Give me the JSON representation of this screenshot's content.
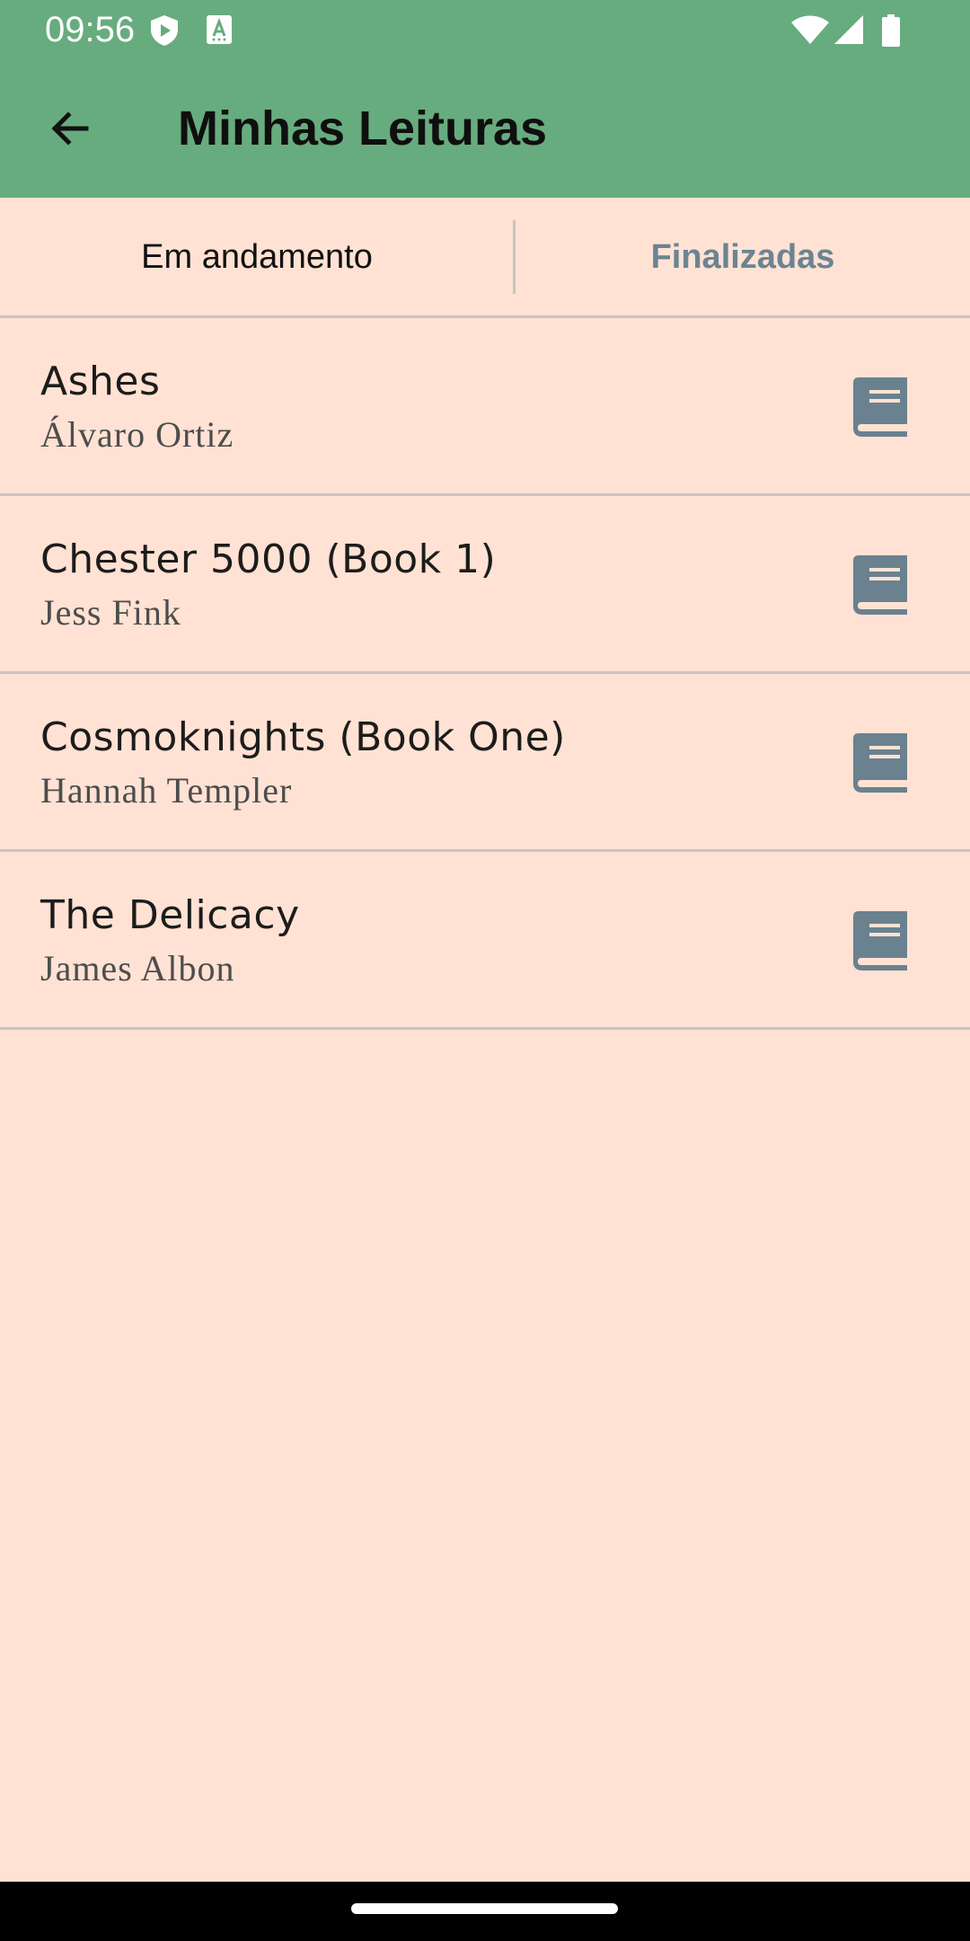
{
  "status_bar": {
    "time": "09:56",
    "icons": [
      "shield-play-icon",
      "accessibility-a-icon",
      "wifi-icon",
      "signal-icon",
      "battery-icon"
    ]
  },
  "app_bar": {
    "title": "Minhas Leituras",
    "back_icon": "arrow-back-icon",
    "background_color": "#67ac7e"
  },
  "tabs": [
    {
      "label": "Em andamento",
      "active": true
    },
    {
      "label": "Finalizadas",
      "active": false
    }
  ],
  "books": [
    {
      "title": "Ashes",
      "author": "Álvaro Ortiz",
      "icon": "book-icon"
    },
    {
      "title": "Chester 5000 (Book 1)",
      "author": "Jess Fink",
      "icon": "book-icon"
    },
    {
      "title": "Cosmoknights (Book One)",
      "author": "Hannah Templer",
      "icon": "book-icon"
    },
    {
      "title": "The Delicacy",
      "author": "James Albon",
      "icon": "book-icon"
    }
  ],
  "colors": {
    "background": "#ffe2d3",
    "accent": "#67ac7e",
    "inactive_tab": "#6c8492",
    "book_icon": "#6a8190"
  }
}
